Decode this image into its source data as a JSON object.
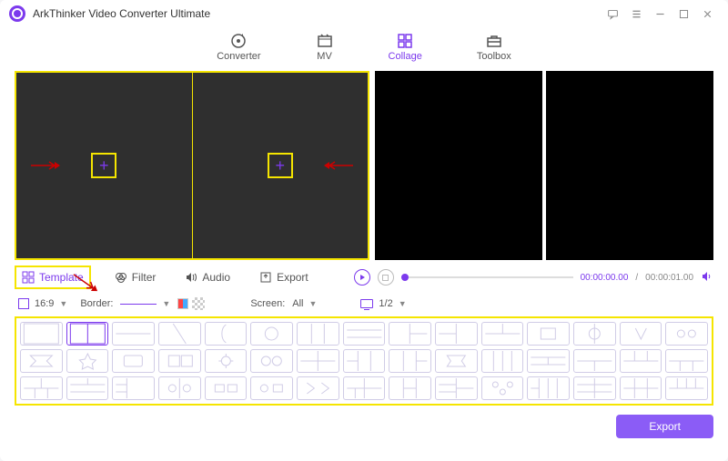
{
  "title": "ArkThinker Video Converter Ultimate",
  "main_tabs": {
    "converter": "Converter",
    "mv": "MV",
    "collage": "Collage",
    "toolbox": "Toolbox",
    "active": "collage"
  },
  "sub_tabs": {
    "template": "Template",
    "filter": "Filter",
    "audio": "Audio",
    "export": "Export",
    "active": "template"
  },
  "playback": {
    "current_time": "00:00:00.00",
    "total_time": "00:00:01.00"
  },
  "toolbar": {
    "ratio": "16:9",
    "border_label": "Border:",
    "screen_label": "Screen:",
    "screen_value": "All",
    "page": "1/2"
  },
  "export_button": "Export",
  "colors": {
    "accent": "#7c3aed",
    "highlight": "#f5e500"
  },
  "template_count": 45
}
